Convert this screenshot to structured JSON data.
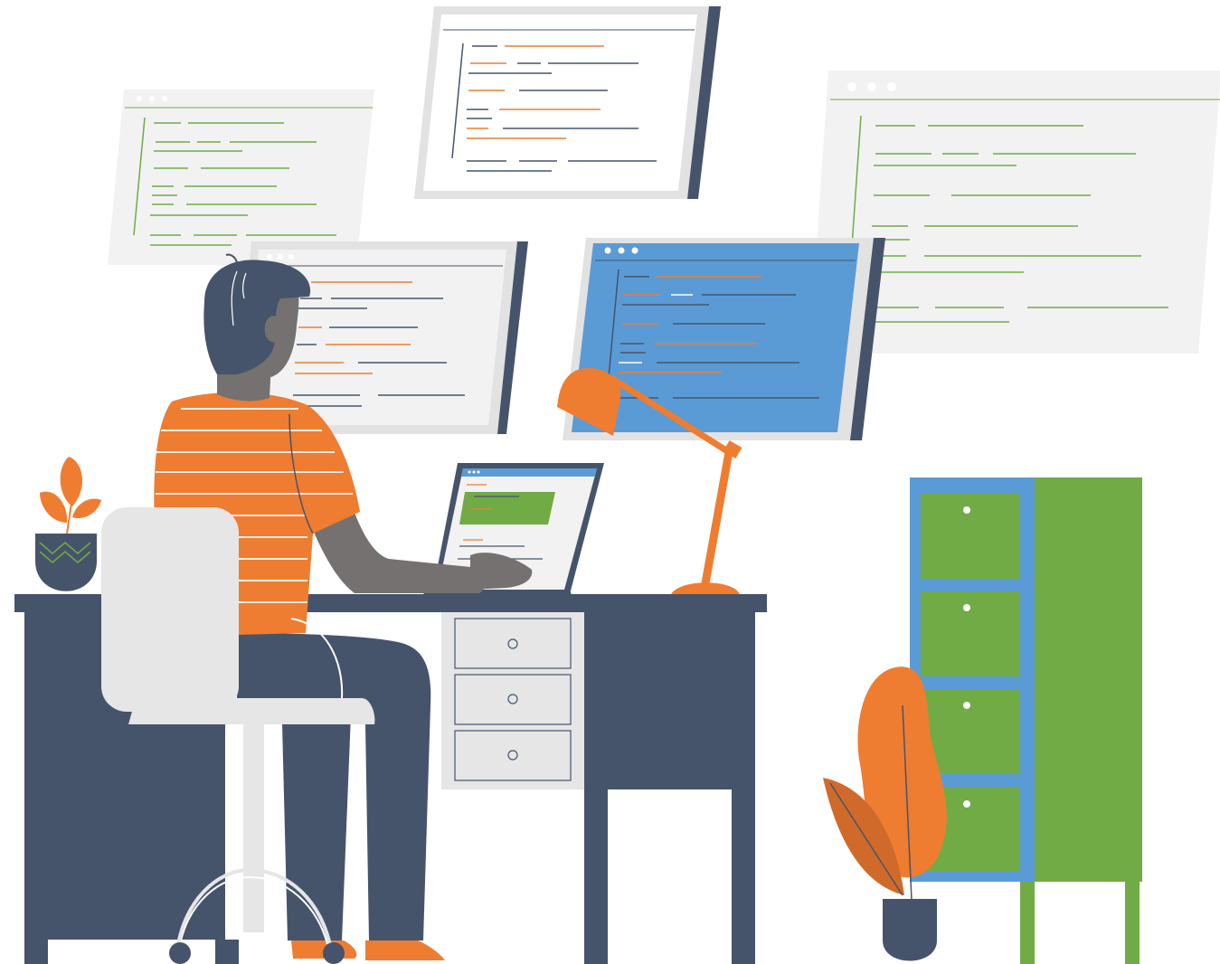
{
  "scene": {
    "subject": "developer-workspace-illustration",
    "windows": [
      {
        "name": "code-window-top-center",
        "theme": "white"
      },
      {
        "name": "code-window-top-left",
        "theme": "light"
      },
      {
        "name": "code-window-right",
        "theme": "light"
      },
      {
        "name": "code-window-middle",
        "theme": "white"
      },
      {
        "name": "code-window-blue",
        "theme": "blue"
      }
    ],
    "cabinet_drawers": 4,
    "desk_drawers": 3
  },
  "colors": {
    "navy": "#46546B",
    "orange": "#EE7D31",
    "green": "#70AB46",
    "blue": "#5B9BD5",
    "light_gray": "#F2F2F2",
    "frame_gray": "#E2E2E2",
    "skin": "#757171",
    "chair": "#E6E6E6"
  }
}
